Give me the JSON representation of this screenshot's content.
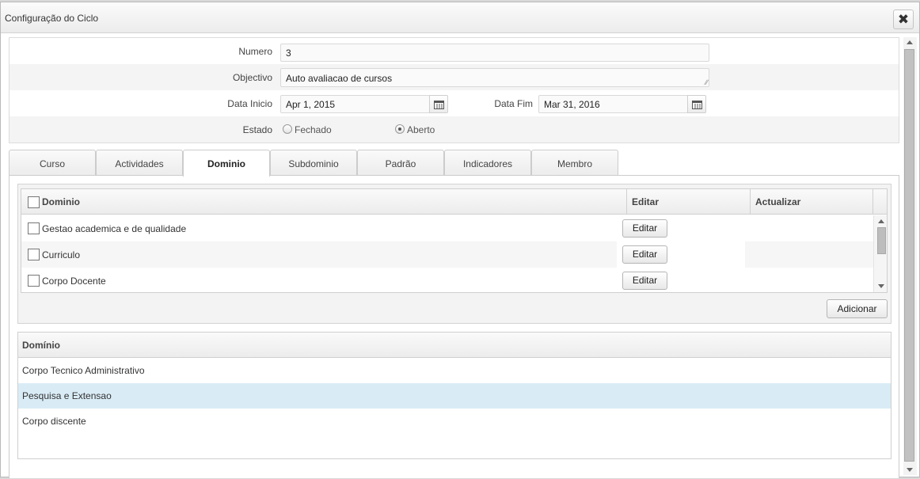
{
  "dialog": {
    "title": "Configuração do Ciclo",
    "close_icon": "close-x-icon"
  },
  "form": {
    "numero_label": "Numero",
    "numero_value": "3",
    "objectivo_label": "Objectivo",
    "objectivo_value": "Auto avaliacao de cursos",
    "data_inicio_label": "Data Inicio",
    "data_inicio_value": "Apr 1, 2015",
    "data_fim_label": "Data Fim",
    "data_fim_value": "Mar 31, 2016",
    "estado_label": "Estado",
    "estado_options": [
      "Fechado",
      "Aberto"
    ],
    "estado_selected": "Aberto"
  },
  "tabs": [
    {
      "label": "Curso"
    },
    {
      "label": "Actividades"
    },
    {
      "label": "Dominio"
    },
    {
      "label": "Subdominio"
    },
    {
      "label": "Padrão"
    },
    {
      "label": "Indicadores"
    },
    {
      "label": "Membro"
    }
  ],
  "active_tab": "Dominio",
  "dominio_table": {
    "columns": [
      "Dominio",
      "Editar",
      "Actualizar"
    ],
    "rows": [
      {
        "name": "Gestao academica e de qualidade",
        "edit_label": "Editar"
      },
      {
        "name": "Curriculo",
        "edit_label": "Editar"
      },
      {
        "name": "Corpo Docente",
        "edit_label": "Editar"
      }
    ],
    "add_label": "Adicionar"
  },
  "dominio_list": {
    "header": "Domínio",
    "items": [
      "Corpo Tecnico Administrativo",
      "Pesquisa e Extensao",
      "Corpo discente"
    ],
    "selected_item": "Pesquisa e Extensao"
  }
}
